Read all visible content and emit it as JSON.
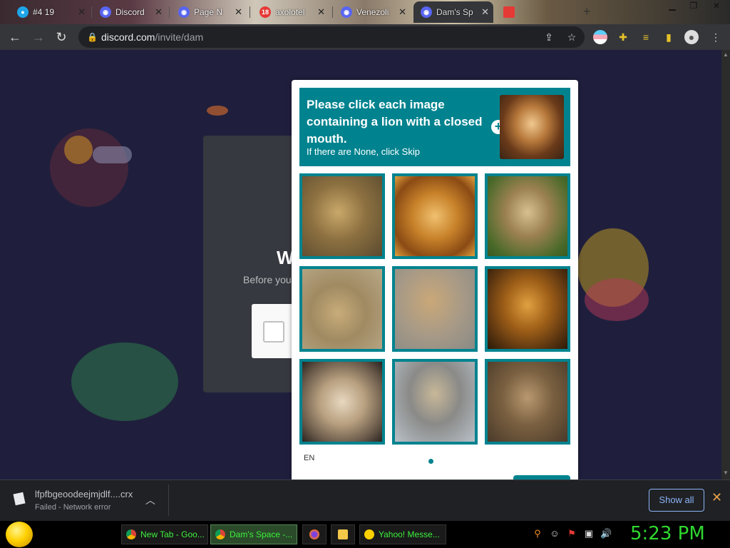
{
  "browser": {
    "tabs": [
      {
        "label": "#4 19",
        "icon": "location-pin-icon",
        "icon_color": "#1ea5e9"
      },
      {
        "label": "Discord",
        "icon": "discord-icon",
        "icon_color": "#5865f2"
      },
      {
        "label": "Page N",
        "icon": "discord-icon",
        "icon_color": "#5865f2"
      },
      {
        "label": "axolotel",
        "icon": "badge-icon",
        "icon_color": "#e53935",
        "badge": "18"
      },
      {
        "label": "Venezoli",
        "icon": "discord-icon",
        "icon_color": "#5865f2"
      },
      {
        "label": "Dam's Sp",
        "icon": "discord-icon",
        "icon_color": "#5865f2"
      },
      {
        "label": "",
        "icon": "flag-icon",
        "icon_color": "#e53935"
      }
    ],
    "new_tab_symbol": "+",
    "url_host": "discord.com",
    "url_path": "/invite/dam"
  },
  "page": {
    "heading": "W",
    "subtext": "Before you"
  },
  "captcha": {
    "prompt": "Please click each image containing a lion with a closed mouth.",
    "hint": "If there are None, click Skip",
    "plus": "+",
    "language": "EN",
    "accent": "#00838f"
  },
  "downloads": {
    "filename": "lfpfbgeoodeejmjdlf....crx",
    "status": "Failed - Network error",
    "show_all": "Show all"
  },
  "taskbar": {
    "items": [
      {
        "label": "New Tab - Goo...",
        "icon": "chrome-icon"
      },
      {
        "label": "Dam's Space -...",
        "icon": "chrome-icon"
      },
      {
        "label": "",
        "icon": "firefox-icon"
      },
      {
        "label": "",
        "icon": "folder-icon"
      },
      {
        "label": "Yahoo! Messe...",
        "icon": "yahoo-messenger-icon"
      }
    ],
    "clock": "5:23 PM"
  }
}
